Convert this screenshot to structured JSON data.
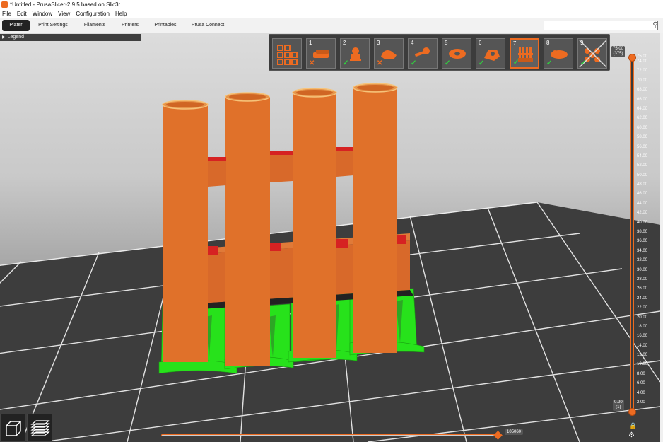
{
  "window": {
    "title": "*Untitled - PrusaSlicer-2.9.5 based on Slic3r"
  },
  "menu": [
    "File",
    "Edit",
    "Window",
    "View",
    "Configuration",
    "Help"
  ],
  "tabs": [
    "Plater",
    "Print Settings",
    "Filaments",
    "Printers",
    "Printables",
    "Prusa Connect"
  ],
  "active_tab": "Plater",
  "search": {
    "value": "",
    "placeholder": ""
  },
  "legend": {
    "label": "Legend"
  },
  "objects": [
    {
      "num": "",
      "status": "",
      "icon": "grid-icon"
    },
    {
      "num": "1",
      "status": "fail",
      "icon": "object-thumbnail-icon"
    },
    {
      "num": "2",
      "status": "ok",
      "icon": "object-thumbnail-icon"
    },
    {
      "num": "3",
      "status": "fail",
      "icon": "object-thumbnail-icon"
    },
    {
      "num": "4",
      "status": "ok",
      "icon": "object-thumbnail-icon"
    },
    {
      "num": "5",
      "status": "ok",
      "icon": "object-thumbnail-icon"
    },
    {
      "num": "6",
      "status": "ok",
      "icon": "object-thumbnail-icon"
    },
    {
      "num": "7",
      "status": "ok",
      "icon": "object-thumbnail-icon",
      "selected": true
    },
    {
      "num": "8",
      "status": "ok",
      "icon": "object-thumbnail-icon"
    },
    {
      "num": "9",
      "status": "ok",
      "icon": "object-thumbnail-icon"
    }
  ],
  "layer_slider": {
    "top_value": "75.00",
    "top_layer": "(375)",
    "bottom_value": "0.20",
    "bottom_layer": "(1)",
    "ticks": [
      "75.00",
      "74.00",
      "72.00",
      "70.00",
      "68.00",
      "66.00",
      "64.00",
      "62.00",
      "60.00",
      "58.00",
      "56.00",
      "54.00",
      "52.00",
      "50.00",
      "48.00",
      "46.00",
      "44.00",
      "42.00",
      "40.00",
      "38.00",
      "36.00",
      "34.00",
      "32.00",
      "30.00",
      "28.00",
      "26.00",
      "24.00",
      "22.00",
      "20.00",
      "18.00",
      "16.00",
      "14.00",
      "12.00",
      "10.00",
      "8.00",
      "6.00",
      "4.00",
      "2.00"
    ]
  },
  "move_slider": {
    "value": "105060"
  },
  "colors": {
    "accent": "#ed6b21",
    "model": "#e0712a",
    "support": "#27e21b",
    "top_surface": "#d62222",
    "bed": "#3a3a3a",
    "grid": "#ffffff"
  }
}
